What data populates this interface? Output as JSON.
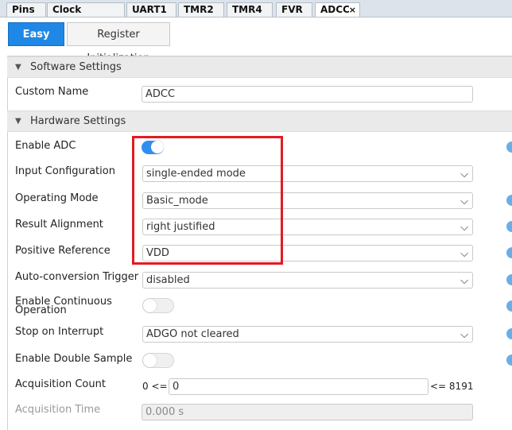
{
  "tabs": [
    {
      "label": "Pins"
    },
    {
      "label": "Clock Control"
    },
    {
      "label": "UART1"
    },
    {
      "label": "TMR2"
    },
    {
      "label": "TMR4"
    },
    {
      "label": "FVR"
    },
    {
      "label": "ADCC",
      "close": "×"
    }
  ],
  "subtabs": {
    "easy_view": "Easy View",
    "register_init": "Register Initialization"
  },
  "sections": {
    "software": "Software Settings",
    "hardware": "Hardware Settings"
  },
  "icons": {
    "collapse": "▼",
    "chevron": "⌵"
  },
  "fields": {
    "custom_name": {
      "label": "Custom Name",
      "value": "ADCC"
    },
    "enable_adc": {
      "label": "Enable ADC",
      "state": true
    },
    "input_config": {
      "label": "Input Configuration",
      "value": "single-ended mode"
    },
    "operating_mode": {
      "label": "Operating Mode",
      "value": "Basic_mode"
    },
    "result_alignment": {
      "label": "Result Alignment",
      "value": "right justified"
    },
    "positive_reference": {
      "label": "Positive Reference",
      "value": "VDD"
    },
    "auto_conversion": {
      "label": "Auto-conversion Trigger",
      "value": "disabled"
    },
    "enable_continuous": {
      "label_line1": "Enable Continuous",
      "label_line2": "Operation",
      "state": false
    },
    "stop_on_interrupt": {
      "label": "Stop on Interrupt",
      "value": "ADGO not cleared"
    },
    "enable_double_sample": {
      "label": "Enable Double Sample",
      "state": false
    },
    "acquisition_count": {
      "label": "Acquisition Count",
      "prefix": "0 <=",
      "value": "0",
      "suffix": "<= 8191"
    },
    "acquisition_time": {
      "label": "Acquisition Time",
      "value": "0.000 s"
    }
  },
  "colors": {
    "accent": "#1f87e5",
    "highlight": "#e21b22",
    "toggle_on": "#2f8ef0"
  }
}
